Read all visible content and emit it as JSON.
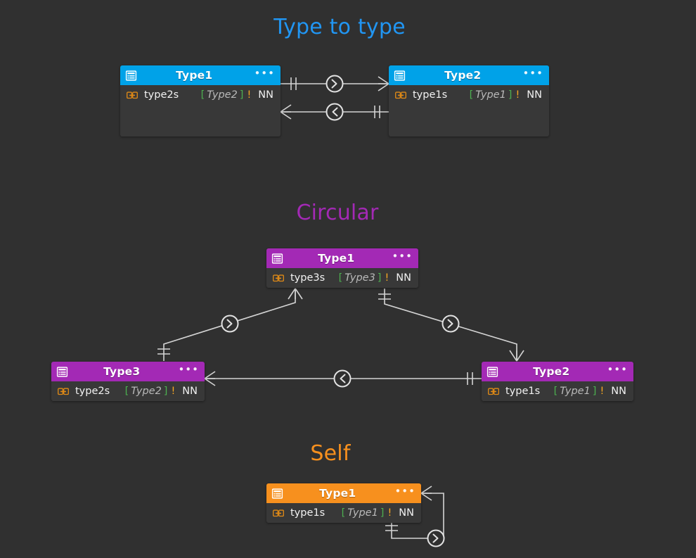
{
  "background": "#303030",
  "sections": [
    {
      "id": "type-to-type",
      "title": "Type to type",
      "title_color": "#2196f3",
      "accent": "#1ca7ec"
    },
    {
      "id": "circular",
      "title": "Circular",
      "title_color": "#a329b5",
      "accent": "#a329b5"
    },
    {
      "id": "self",
      "title": "Self",
      "title_color": "#f7901e",
      "accent": "#f7901e"
    }
  ],
  "nodes": [
    {
      "id": "t2t-type1",
      "section": "type-to-type",
      "title": "Type1",
      "header_color": "#00a2e8",
      "header_icon": "table-icon",
      "menu_icon": "ellipsis-icon",
      "menu_label": "•••",
      "fields": [
        {
          "icon": "relation-link-icon",
          "name": "type2s",
          "open_bracket": "[",
          "type": "Type2",
          "close_bracket": "]",
          "required": "!",
          "modifier": "NN"
        }
      ]
    },
    {
      "id": "t2t-type2",
      "section": "type-to-type",
      "title": "Type2",
      "header_color": "#00a2e8",
      "header_icon": "table-icon",
      "menu_icon": "ellipsis-icon",
      "menu_label": "•••",
      "fields": [
        {
          "icon": "relation-link-icon",
          "name": "type1s",
          "open_bracket": "[",
          "type": "Type1",
          "close_bracket": "]",
          "required": "!",
          "modifier": "NN"
        }
      ]
    },
    {
      "id": "circ-type1",
      "section": "circular",
      "title": "Type1",
      "header_color": "#a329b5",
      "header_icon": "table-icon",
      "menu_icon": "ellipsis-icon",
      "menu_label": "•••",
      "fields": [
        {
          "icon": "relation-link-icon",
          "name": "type3s",
          "open_bracket": "[",
          "type": "Type3",
          "close_bracket": "]",
          "required": "!",
          "modifier": "NN"
        }
      ]
    },
    {
      "id": "circ-type3",
      "section": "circular",
      "title": "Type3",
      "header_color": "#a329b5",
      "header_icon": "table-icon",
      "menu_icon": "ellipsis-icon",
      "menu_label": "•••",
      "fields": [
        {
          "icon": "relation-link-icon",
          "name": "type2s",
          "open_bracket": "[",
          "type": "Type2",
          "close_bracket": "]",
          "required": "!",
          "modifier": "NN"
        }
      ]
    },
    {
      "id": "circ-type2",
      "section": "circular",
      "title": "Type2",
      "header_color": "#a329b5",
      "header_icon": "table-icon",
      "menu_icon": "ellipsis-icon",
      "menu_label": "•••",
      "fields": [
        {
          "icon": "relation-link-icon",
          "name": "type1s",
          "open_bracket": "[",
          "type": "Type1",
          "close_bracket": "]",
          "required": "!",
          "modifier": "NN"
        }
      ]
    },
    {
      "id": "self-type1",
      "section": "self",
      "title": "Type1",
      "header_color": "#f7901e",
      "header_icon": "table-icon",
      "menu_icon": "ellipsis-icon",
      "menu_label": "•••",
      "fields": [
        {
          "icon": "relation-link-icon",
          "name": "type1s",
          "open_bracket": "[",
          "type": "Type1",
          "close_bracket": "]",
          "required": "!",
          "modifier": "NN"
        }
      ]
    }
  ],
  "edges": {
    "line_color": "#d4d4d4",
    "marker_many": "crows-foot-marker",
    "marker_one": "one-bar-marker",
    "marker_direction": "chevron-circle-marker"
  }
}
